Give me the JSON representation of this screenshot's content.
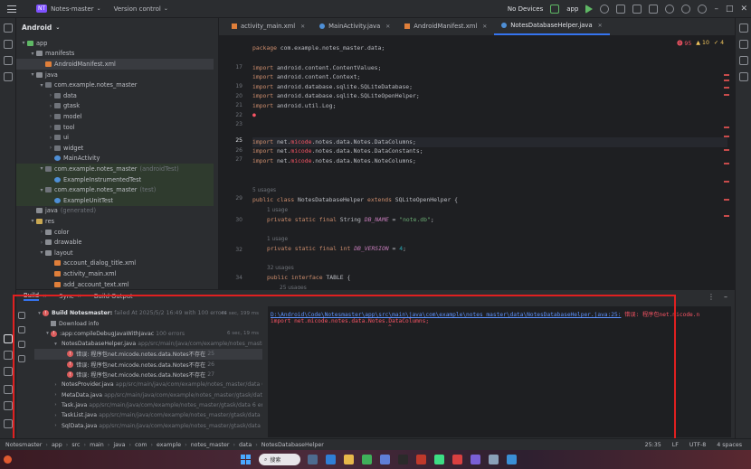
{
  "titlebar": {
    "project_badge": "NT",
    "project_name": "Notes-master",
    "vcs": "Version control",
    "devices": "No Devices",
    "run_config": "app"
  },
  "project_panel": {
    "header": "Android",
    "rows": [
      {
        "label": "app",
        "indent": 0,
        "icon": "mod",
        "tw": "▾"
      },
      {
        "label": "manifests",
        "indent": 1,
        "icon": "folder",
        "tw": "▾"
      },
      {
        "label": "AndroidManifest.xml",
        "indent": 2,
        "icon": "xml",
        "tw": "",
        "sel": true
      },
      {
        "label": "java",
        "indent": 1,
        "icon": "folder",
        "tw": "▾"
      },
      {
        "label": "com.example.notes_master",
        "indent": 2,
        "icon": "pkg",
        "tw": "▾"
      },
      {
        "label": "data",
        "indent": 3,
        "icon": "pkg",
        "tw": "›"
      },
      {
        "label": "gtask",
        "indent": 3,
        "icon": "pkg",
        "tw": "›"
      },
      {
        "label": "model",
        "indent": 3,
        "icon": "pkg",
        "tw": "›"
      },
      {
        "label": "tool",
        "indent": 3,
        "icon": "pkg",
        "tw": "›"
      },
      {
        "label": "ui",
        "indent": 3,
        "icon": "pkg",
        "tw": "›"
      },
      {
        "label": "widget",
        "indent": 3,
        "icon": "pkg",
        "tw": "›"
      },
      {
        "label": "MainActivity",
        "indent": 3,
        "icon": "java",
        "tw": ""
      },
      {
        "label": "com.example.notes_master",
        "dim": "(androidTest)",
        "indent": 2,
        "icon": "pkg",
        "tw": "▾",
        "green": true
      },
      {
        "label": "ExampleInstrumentedTest",
        "indent": 3,
        "icon": "java",
        "tw": "",
        "green": true
      },
      {
        "label": "com.example.notes_master",
        "dim": "(test)",
        "indent": 2,
        "icon": "pkg",
        "tw": "▾",
        "green": true
      },
      {
        "label": "ExampleUnitTest",
        "indent": 3,
        "icon": "java",
        "tw": "",
        "green": true
      },
      {
        "label": "java",
        "dim": "(generated)",
        "indent": 1,
        "icon": "folder",
        "tw": ""
      },
      {
        "label": "res",
        "indent": 1,
        "icon": "res",
        "tw": "▾"
      },
      {
        "label": "color",
        "indent": 2,
        "icon": "folder",
        "tw": "›"
      },
      {
        "label": "drawable",
        "indent": 2,
        "icon": "folder",
        "tw": "›"
      },
      {
        "label": "layout",
        "indent": 2,
        "icon": "folder",
        "tw": "▾"
      },
      {
        "label": "account_dialog_title.xml",
        "indent": 3,
        "icon": "xml",
        "tw": ""
      },
      {
        "label": "activity_main.xml",
        "indent": 3,
        "icon": "xml",
        "tw": ""
      },
      {
        "label": "add_account_text.xml",
        "indent": 3,
        "icon": "xml",
        "tw": ""
      }
    ]
  },
  "editor": {
    "tabs": [
      {
        "label": "activity_main.xml",
        "icon": "xml"
      },
      {
        "label": "MainActivity.java",
        "icon": "java"
      },
      {
        "label": "AndroidManifest.xml",
        "icon": "xml"
      },
      {
        "label": "NotesDatabaseHelper.java",
        "icon": "java",
        "active": true
      }
    ],
    "errors": "95",
    "warnings": "10",
    "weak_warnings": "4",
    "line_numbers": [
      "17",
      "",
      "19",
      "20",
      "21",
      "22",
      "23",
      "24",
      "25",
      "26",
      "27",
      "",
      "",
      "",
      "",
      "",
      "",
      "",
      "",
      "",
      "",
      "",
      "",
      "",
      "36"
    ],
    "ln_25": "25",
    "ln_36": "36"
  },
  "build": {
    "tabs": [
      "Build",
      "Sync",
      "Build Output"
    ],
    "rows": [
      {
        "label": "Build Notesmaster:",
        "extra": "failed At 2025/5/2 16:49 with 100 errors",
        "time": "44 sec, 199 ms",
        "indent": 0,
        "kind": "err",
        "bold": true
      },
      {
        "label": "Download info",
        "indent": 1,
        "kind": "dl"
      },
      {
        "label": ":app:compileDebugJavaWithJavac",
        "extra": "100 errors",
        "time": "6 sec, 19 ms",
        "indent": 1,
        "kind": "err"
      },
      {
        "label": "NotesDatabaseHelper.java",
        "extra": "app/src/main/java/com/example/notes_master",
        "indent": 2,
        "kind": "file"
      },
      {
        "label": "错误: 程序包net.micode.notes.data.Notes不存在",
        "extra": "25",
        "indent": 3,
        "kind": "err",
        "sel": true
      },
      {
        "label": "错误: 程序包net.micode.notes.data.Notes不存在",
        "extra": "26",
        "indent": 3,
        "kind": "err"
      },
      {
        "label": "错误: 程序包net.micode.notes.data.Notes不存在",
        "extra": "27",
        "indent": 3,
        "kind": "err"
      },
      {
        "label": "NotesProvider.java",
        "extra": "app/src/main/java/com/example/notes_master/data 6 errors",
        "indent": 2,
        "kind": "file"
      },
      {
        "label": "MetaData.java",
        "extra": "app/src/main/java/com/example/notes_master/gtask/data 1",
        "indent": 2,
        "kind": "file"
      },
      {
        "label": "Task.java",
        "extra": "app/src/main/java/com/example/notes_master/gtask/data 6 errors",
        "indent": 2,
        "kind": "file"
      },
      {
        "label": "TaskList.java",
        "extra": "app/src/main/java/com/example/notes_master/gtask/data 4 er",
        "indent": 2,
        "kind": "file"
      },
      {
        "label": "SqlData.java",
        "extra": "app/src/main/java/com/example/notes_master/gtask/data 4 e",
        "indent": 2,
        "kind": "file"
      }
    ],
    "output_path": "D:\\Android\\Code\\Notesmaster\\app\\src\\main\\java\\com\\example\\notes_master\\data\\NotesDatabaseHelper.java:25:",
    "output_err1": " 错误: 程序包net.micode.n",
    "output_err2": "import net.micode.notes.data.Notes.DataColumns;",
    "caret": "^"
  },
  "statusbar": {
    "crumbs": [
      "Notesmaster",
      "app",
      "src",
      "main",
      "java",
      "com",
      "example",
      "notes_master",
      "data",
      "NotesDatabaseHelper"
    ],
    "position": "25:35",
    "line_sep": "LF",
    "encoding": "UTF-8",
    "indent": "4 spaces"
  },
  "taskbar": {
    "search": "搜索"
  },
  "colors": {
    "accent": "#3574f0",
    "error": "#f75464",
    "highlight_box": "#e02020"
  }
}
